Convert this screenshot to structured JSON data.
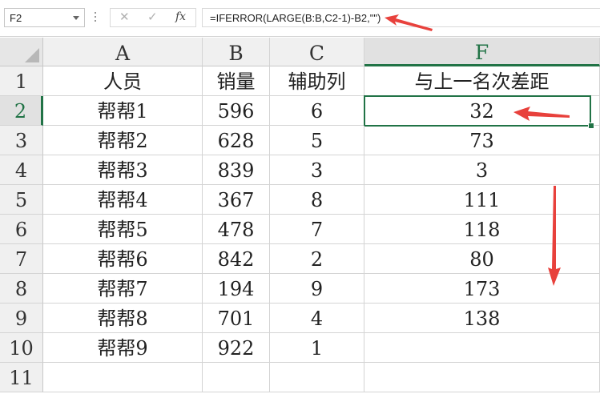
{
  "formula_bar": {
    "name_box": "F2",
    "cancel_icon": "x-icon",
    "enter_icon": "check-icon",
    "fx_label": "fx",
    "formula": "=IFERROR(LARGE(B:B,C2-1)-B2,\"\")"
  },
  "columns": [
    "A",
    "B",
    "C",
    "F"
  ],
  "selected_cell": "F2",
  "rows": [
    {
      "row": "1",
      "a": "人员",
      "b": "销量",
      "c": "辅助列",
      "f": "与上一名次差距"
    },
    {
      "row": "2",
      "a": "帮帮1",
      "b": "596",
      "c": "6",
      "f": "32"
    },
    {
      "row": "3",
      "a": "帮帮2",
      "b": "628",
      "c": "5",
      "f": "73"
    },
    {
      "row": "4",
      "a": "帮帮3",
      "b": "839",
      "c": "3",
      "f": "3"
    },
    {
      "row": "5",
      "a": "帮帮4",
      "b": "367",
      "c": "8",
      "f": "111"
    },
    {
      "row": "6",
      "a": "帮帮5",
      "b": "478",
      "c": "7",
      "f": "118"
    },
    {
      "row": "7",
      "a": "帮帮6",
      "b": "842",
      "c": "2",
      "f": "80"
    },
    {
      "row": "8",
      "a": "帮帮7",
      "b": "194",
      "c": "9",
      "f": "173"
    },
    {
      "row": "9",
      "a": "帮帮8",
      "b": "701",
      "c": "4",
      "f": "138"
    },
    {
      "row": "10",
      "a": "帮帮9",
      "b": "922",
      "c": "1",
      "f": ""
    },
    {
      "row": "11",
      "a": "",
      "b": "",
      "c": "",
      "f": ""
    }
  ],
  "colors": {
    "accent": "#217346",
    "annotation_arrow": "#e8413c"
  }
}
